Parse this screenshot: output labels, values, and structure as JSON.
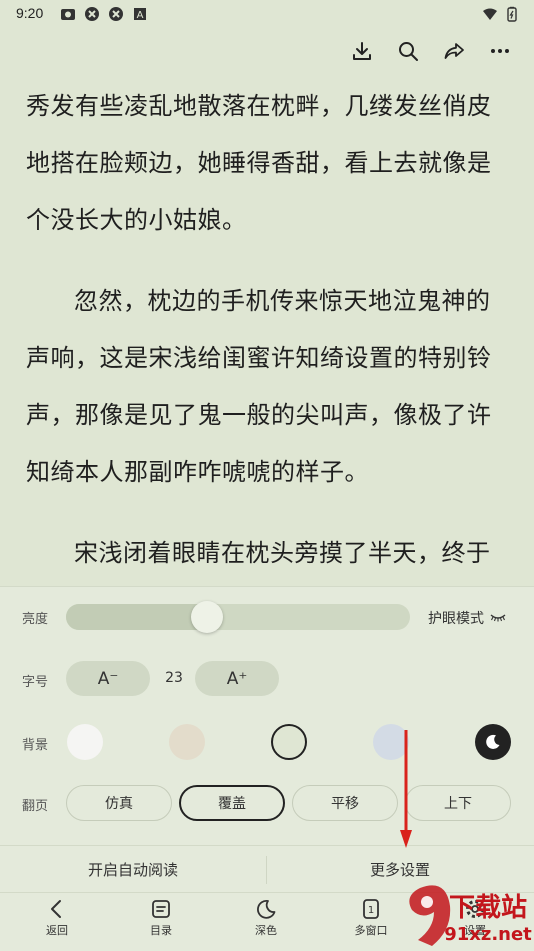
{
  "status_bar": {
    "time": "9:20"
  },
  "toolbar": {
    "icons": [
      "download-icon",
      "search-icon",
      "share-icon",
      "more-icon"
    ]
  },
  "reader": {
    "paragraphs": [
      "秀发有些凌乱地散落在枕畔，几缕发丝俏皮地搭在脸颊边，她睡得香甜，看上去就像是个没长大的小姑娘。",
      "忽然，枕边的手机传来惊天地泣鬼神的声响，这是宋浅给闺蜜许知绮设置的特别铃声，那像是见了鬼一般的尖叫声，像极了许知绮本人那副咋咋唬唬的样子。",
      "宋浅闭着眼睛在枕头旁摸了半天，终于摸到了手机，声音慵懒，“喂？”"
    ]
  },
  "settings": {
    "brightness": {
      "label": "亮度",
      "value": 0.41,
      "eye_mode_label": "护眼模式"
    },
    "font": {
      "label": "字号",
      "decrease_label": "A⁻",
      "increase_label": "A⁺",
      "size": "23"
    },
    "background": {
      "label": "背景",
      "swatches": [
        {
          "name": "white",
          "color": "#f5f5f3"
        },
        {
          "name": "beige",
          "color": "#e3dccb"
        },
        {
          "name": "green",
          "color": "#dfe6d3"
        },
        {
          "name": "blue",
          "color": "#d3dbe5"
        },
        {
          "name": "dark",
          "color": "#222222"
        }
      ],
      "selected": "green"
    },
    "page_turn": {
      "label": "翻页",
      "options": [
        "仿真",
        "覆盖",
        "平移",
        "上下"
      ],
      "selected": "覆盖"
    },
    "auto_read_label": "开启自动阅读",
    "more_settings_label": "更多设置"
  },
  "bottom_nav": [
    {
      "label": "返回",
      "icon": "back-icon"
    },
    {
      "label": "目录",
      "icon": "toc-icon"
    },
    {
      "label": "深色",
      "icon": "moon-icon"
    },
    {
      "label": "多窗口",
      "icon": "multi-window-icon"
    },
    {
      "label": "设置",
      "icon": "settings-icon"
    }
  ],
  "watermark": {
    "text_top": "下载站",
    "text_bottom": "91xz.net"
  },
  "colors": {
    "background": "#dfe6d3",
    "panel": "#e4eadb",
    "accent_arrow": "#d9221c"
  }
}
